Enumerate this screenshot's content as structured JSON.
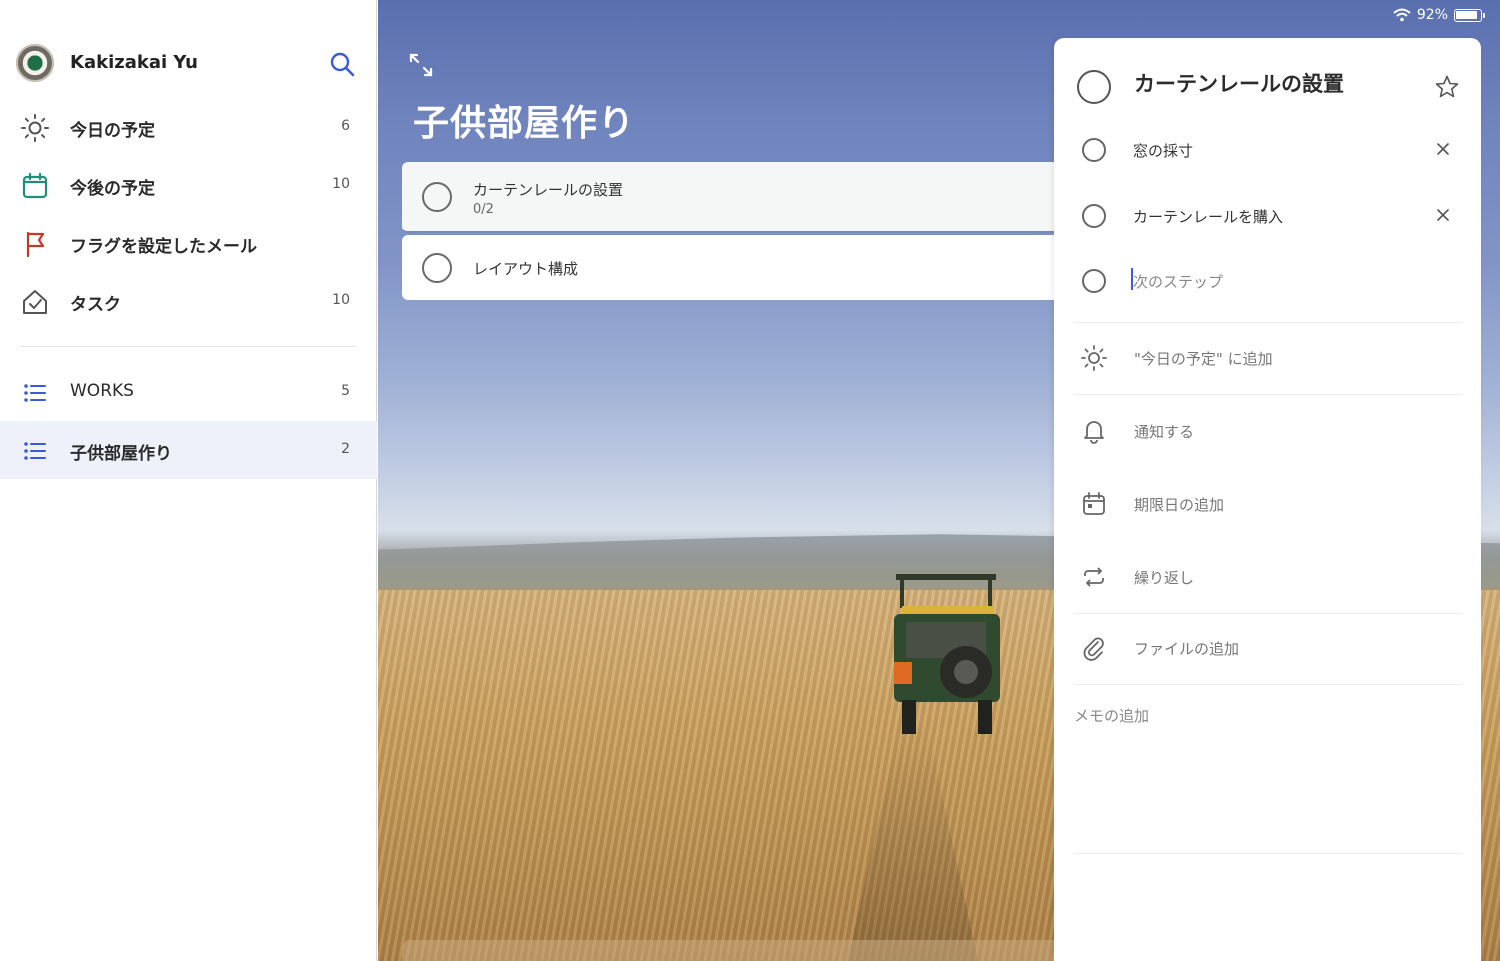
{
  "status_bar": {
    "battery_percent": "92%"
  },
  "profile": {
    "name": "Kakizakai Yu"
  },
  "nav": {
    "items": [
      {
        "label": "今日の予定",
        "count": "6",
        "icon": "sun-icon"
      },
      {
        "label": "今後の予定",
        "count": "10",
        "icon": "calendar-icon"
      },
      {
        "label": "フラグを設定したメール",
        "count": "",
        "icon": "flag-icon"
      },
      {
        "label": "タスク",
        "count": "10",
        "icon": "home-check-icon"
      }
    ],
    "lists": [
      {
        "label": "WORKS",
        "count": "5",
        "icon": "list-icon"
      },
      {
        "label": "子供部屋作り",
        "count": "2",
        "icon": "list-icon",
        "selected": true
      }
    ]
  },
  "main": {
    "title": "子供部屋作り",
    "tasks": [
      {
        "title": "カーテンレールの設置",
        "subtitle": "0/2"
      },
      {
        "title": "レイアウト構成",
        "subtitle": ""
      }
    ]
  },
  "detail": {
    "title": "カーテンレールの設置",
    "steps": [
      {
        "label": "窓の採寸"
      },
      {
        "label": "カーテンレールを購入"
      }
    ],
    "next_step_placeholder": "次のステップ",
    "options": {
      "add_today": "\"今日の予定\" に追加",
      "remind": "通知する",
      "due_date": "期限日の追加",
      "repeat": "繰り返し",
      "add_file": "ファイルの追加"
    },
    "memo_placeholder": "メモの追加"
  },
  "colors": {
    "accent": "#3b5bd6",
    "calendar_teal": "#1f8f7a",
    "flag_red": "#c0392b",
    "selected_row": "#eef1fa"
  }
}
